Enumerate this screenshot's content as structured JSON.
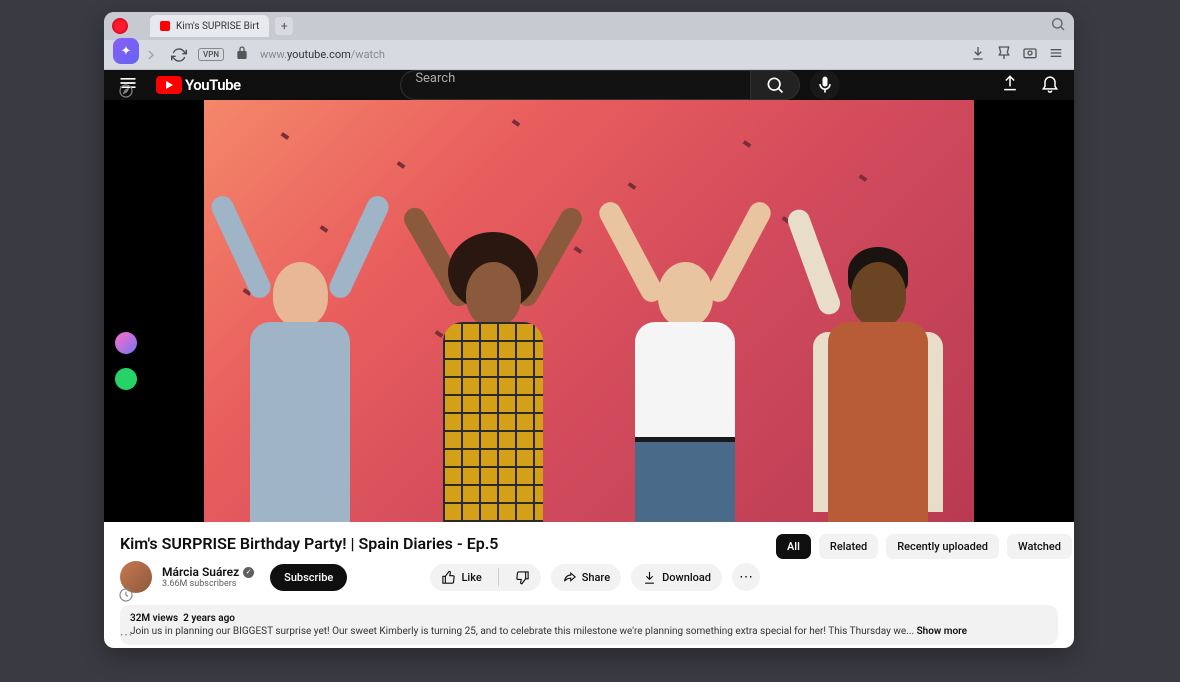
{
  "browser": {
    "tab_title": "Kim's SUPRISE Birt",
    "url_prefix": "www.",
    "url_domain": "youtube.com",
    "url_path": "/watch",
    "vpn_label": "VPN"
  },
  "youtube": {
    "logo_text": "YouTube",
    "search_placeholder": "Search"
  },
  "video": {
    "title": "Kim's SURPRISE Birthday Party! | Spain Diaries - Ep.5",
    "channel_name": "Márcia Suárez",
    "subscriber_count": "3.66M subscribers",
    "subscribe_label": "Subscribe",
    "like_label": "Like",
    "share_label": "Share",
    "download_label": "Download",
    "views": "32M views",
    "age": "2 years ago",
    "description": "Join us in planning our BIGGEST surprise yet! Our sweet Kimberly is turning 25, and to celebrate this milestone we're planning something extra special for her! This Thursday we...",
    "show_more": "Show more"
  },
  "chips": [
    "All",
    "Related",
    "Recently uploaded",
    "Watched"
  ]
}
